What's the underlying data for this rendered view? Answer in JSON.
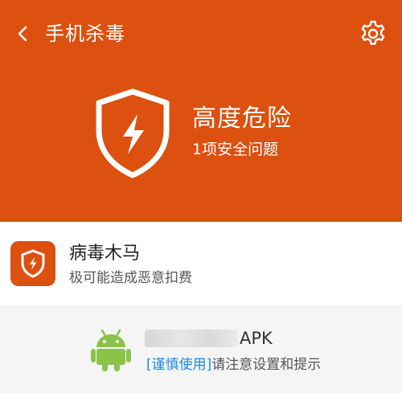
{
  "header": {
    "title": "手机杀毒",
    "back_icon": "chevron-left-icon",
    "settings_icon": "gear-icon",
    "background_color": "#dc5010"
  },
  "status": {
    "icon": "shield-lightning-icon",
    "level": "高度危险",
    "summary": "1项安全问题"
  },
  "threat": {
    "icon": "shield-lightning-icon",
    "name": "病毒木马",
    "description": "极可能造成恶意扣费"
  },
  "app": {
    "icon": "android-icon",
    "name_suffix": "APK",
    "tag": "[谨慎使用]",
    "tag_color": "#1e88e5",
    "note": "请注意设置和提示"
  }
}
